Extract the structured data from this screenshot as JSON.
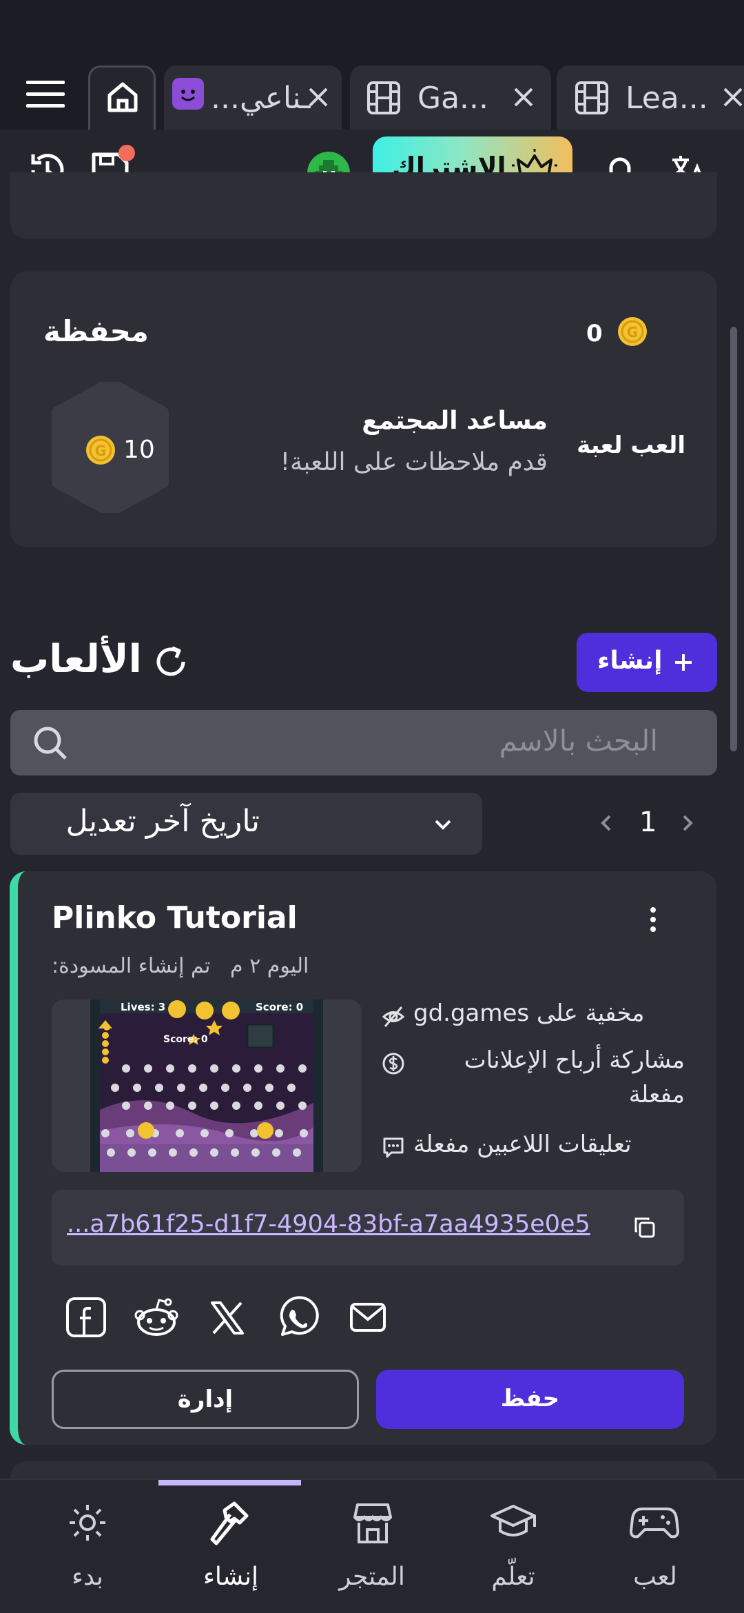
{
  "tabs": [
    {
      "label": "...ـناعي"
    },
    {
      "label": "Ga..."
    },
    {
      "label": "Lea..."
    }
  ],
  "toolbar": {
    "subscribe_label": "الاشتراك"
  },
  "wallet": {
    "title": "محفظة",
    "balance": "0",
    "reward_amount": "10",
    "assistant_title": "مساعد المجتمع",
    "assistant_subtitle": "قدم ملاحظات على اللعبة!",
    "play_label": "العب لعبة"
  },
  "games_section": {
    "title": "الألعاب",
    "create_label": "إنشاء",
    "search_placeholder": "البحث بالاسم",
    "sort_value": "تاريخ آخر تعديل",
    "page_number": "1"
  },
  "game_card": {
    "title": "Plinko Tutorial",
    "created_text": "اليوم ٢ م   تم إنشاء المسودة:",
    "thumb_lives": "Lives: 3",
    "thumb_score": "Score: 0",
    "thumb_score_small": "Score: 0",
    "info_hidden": "مخفية على gd.games",
    "info_ads_line1": "مشاركة أرباح الإعلانات",
    "info_ads_line2": "مفعلة",
    "info_comments": "تعليقات اللاعبين مفعلة",
    "link": "...a7b61f25-d1f7-4904-83bf-a7aa4935e0e5",
    "manage_label": "إدارة",
    "save_label": "حفظ"
  },
  "bottom_nav": [
    {
      "label": "بدء"
    },
    {
      "label": "إنشاء"
    },
    {
      "label": "المتجر"
    },
    {
      "label": "تعلّم"
    },
    {
      "label": "لعب"
    }
  ],
  "colors": {
    "accent": "#4f2fdc",
    "card": "#2e2e37",
    "highlight": "#3fd9a6"
  }
}
